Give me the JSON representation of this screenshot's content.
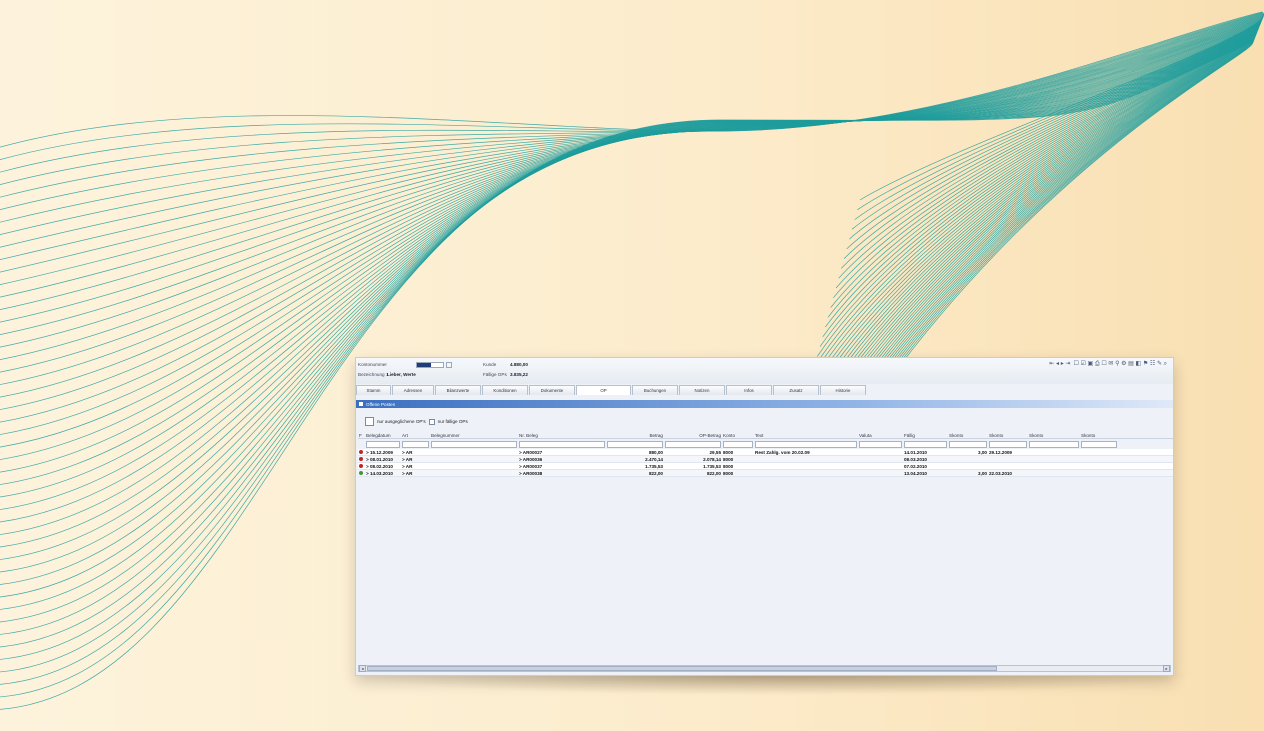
{
  "header": {
    "field1_label": "Kontonummer",
    "field2_label": "Kunde",
    "field2_value": "4.880,00",
    "field3_label": "Bezeichnung 1",
    "field3_value": "Lieber, Werte",
    "field4_label": "Fällige OPs",
    "field4_value": "3.835,22"
  },
  "toolbar": {
    "nav_icons": "⇤ ◂ ▸ ⇥",
    "tools_icons": "☐ ☑ ▣ ⎙ ☐ ✉ ⚲ ⚙ ▤ ◧ ⚑ ☷ ✎ ⌕"
  },
  "tabs": [
    "Stamm",
    "Adressen",
    "Bilanzwerte",
    "Konditionen",
    "Dokumente",
    "OP",
    "Buchungen",
    "Notizen",
    "Infos",
    "Zusatz",
    "Historie"
  ],
  "section": {
    "title": "Offene Posten"
  },
  "filters": {
    "only_balanced_label": "nur ausgeglichene OP's",
    "only_due_label": "nur fällige OPs"
  },
  "table": {
    "columns": [
      "F",
      "Belegdatum",
      "Art",
      "Belegnummer",
      "Nr. Beleg",
      "Betrag",
      "OP-Betrag",
      "Konto",
      "Text",
      "Valuta",
      "Fällig",
      "Skonto",
      "Skonto",
      "Skonto",
      "Skonto"
    ],
    "rows": [
      {
        "status_color": "#c0262a",
        "date": "> 15.12.2009",
        "type": "> AR",
        "doc": "> AR00027",
        "amount": "880,00",
        "op": "29,55",
        "konto": "8000",
        "text": "Rest Zahlg. vom 20.02.09",
        "due": "14.01.2010",
        "skonto_pct": "3,00",
        "skonto_date": "29.12.2009"
      },
      {
        "status_color": "#c0262a",
        "date": "> 08.01.2010",
        "type": "> AR",
        "doc": "> AR00036",
        "amount": "2.470,14",
        "op": "2.078,14",
        "konto": "8000",
        "text": "",
        "due": "08.03.2010",
        "skonto_pct": "",
        "skonto_date": ""
      },
      {
        "status_color": "#c0262a",
        "date": "> 08.02.2010",
        "type": "> AR",
        "doc": "> AR00037",
        "amount": "1.735,53",
        "op": "1.735,53",
        "konto": "8000",
        "text": "",
        "due": "07.02.2010",
        "skonto_pct": "",
        "skonto_date": ""
      },
      {
        "status_color": "#3a9a3a",
        "date": "> 14.03.2010",
        "type": "> AR",
        "doc": "> AR00038",
        "amount": "822,00",
        "op": "822,00",
        "konto": "8000",
        "text": "",
        "due": "13.04.2010",
        "skonto_pct": "3,00",
        "skonto_date": "22.03.2010"
      }
    ]
  },
  "colors": {
    "background_light": "#fdf3dc",
    "background_warm": "#f9dfb2",
    "wave_line": "#1f9c9c",
    "section_header": "#3c6fc0"
  }
}
